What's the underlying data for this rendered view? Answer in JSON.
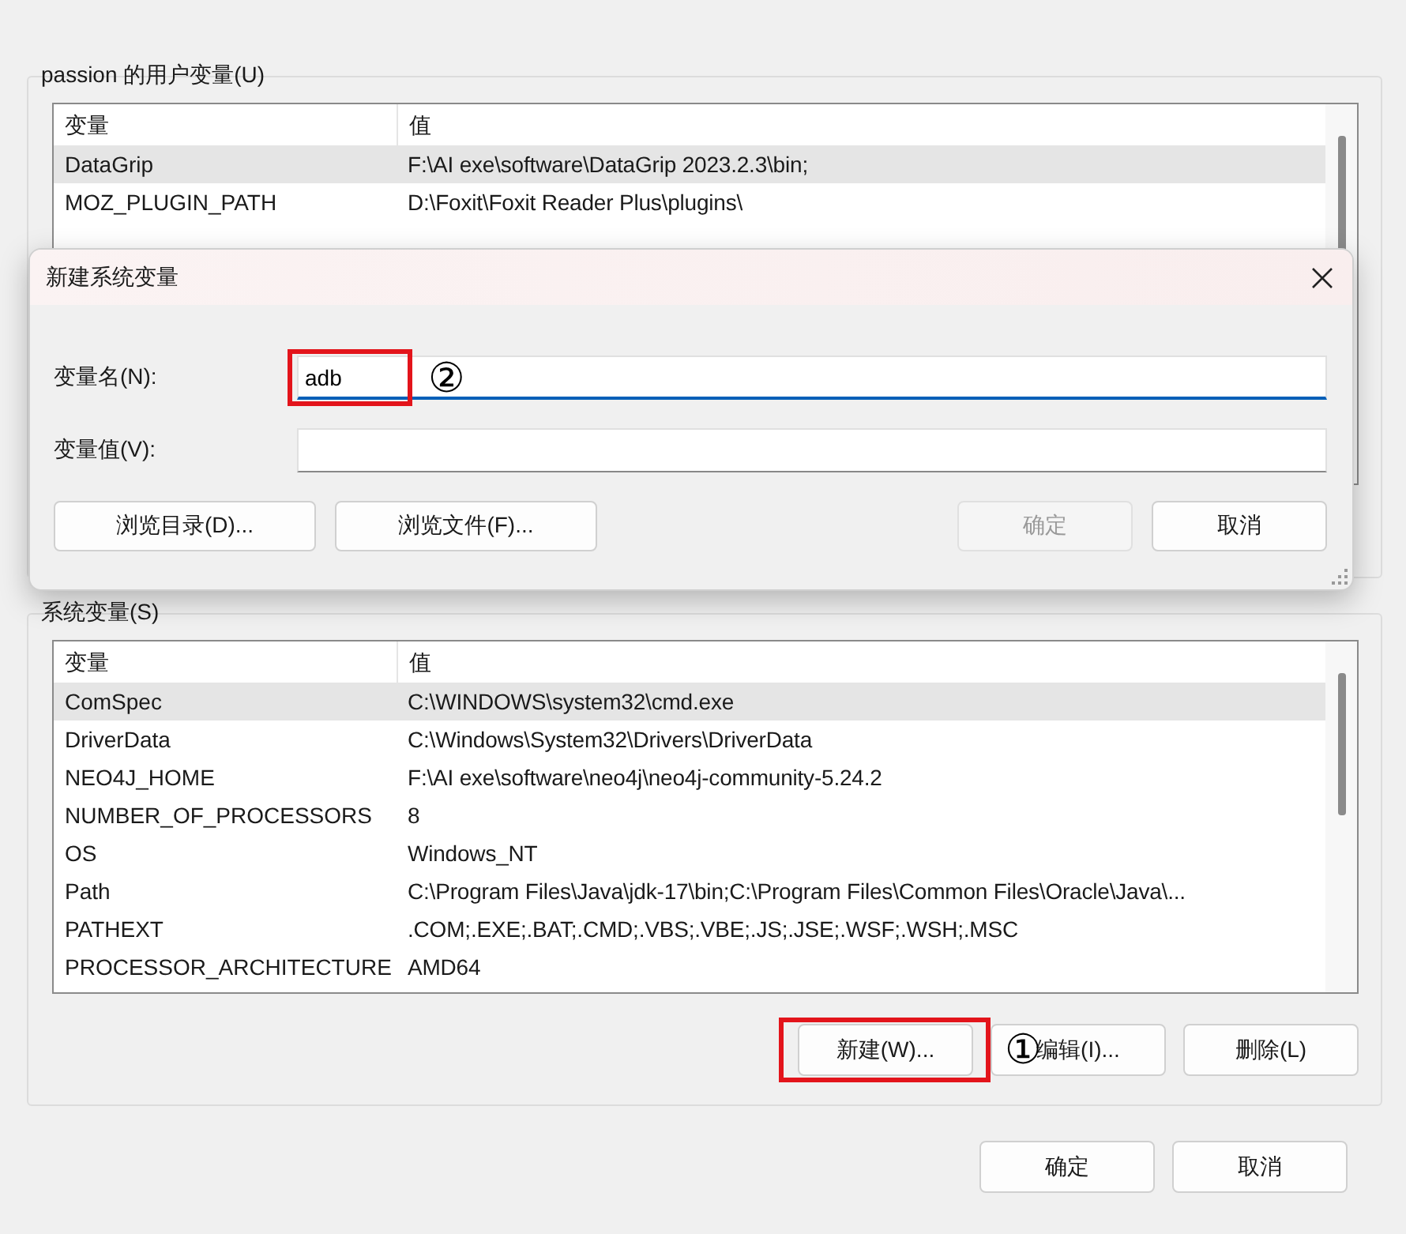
{
  "user_variables": {
    "title": "passion 的用户变量(U)",
    "columns": [
      "变量",
      "值"
    ],
    "rows": [
      {
        "name": "DataGrip",
        "value": "F:\\AI exe\\software\\DataGrip 2023.2.3\\bin;",
        "selected": true
      },
      {
        "name": "MOZ_PLUGIN_PATH",
        "value": "D:\\Foxit\\Foxit Reader Plus\\plugins\\",
        "selected": false
      }
    ]
  },
  "dialog": {
    "title": "新建系统变量",
    "fields": [
      {
        "label": "变量名(N):",
        "value": "adb",
        "focused": true,
        "highlighted": true,
        "annotation": "②"
      },
      {
        "label": "变量值(V):",
        "focused": false,
        "highlighted": false
      }
    ],
    "browse_buttons": [
      {
        "label": "浏览目录(D)...",
        "disabled": false
      },
      {
        "label": "浏览文件(F)...",
        "disabled": false
      }
    ],
    "buttons": [
      {
        "label": "确定",
        "disabled": true
      },
      {
        "label": "取消",
        "disabled": false
      }
    ]
  },
  "system_variables": {
    "title": "系统变量(S)",
    "columns": [
      "变量",
      "值"
    ],
    "rows": [
      {
        "name": "ComSpec",
        "value": "C:\\WINDOWS\\system32\\cmd.exe",
        "selected": true
      },
      {
        "name": "DriverData",
        "value": "C:\\Windows\\System32\\Drivers\\DriverData",
        "selected": false
      },
      {
        "name": "NEO4J_HOME",
        "value": "F:\\AI exe\\software\\neo4j\\neo4j-community-5.24.2",
        "selected": false
      },
      {
        "name": "NUMBER_OF_PROCESSORS",
        "value": "8",
        "selected": false
      },
      {
        "name": "OS",
        "value": "Windows_NT",
        "selected": false
      },
      {
        "name": "Path",
        "value": "C:\\Program Files\\Java\\jdk-17\\bin;C:\\Program Files\\Common Files\\Oracle\\Java\\...",
        "selected": false
      },
      {
        "name": "PATHEXT",
        "value": ".COM;.EXE;.BAT;.CMD;.VBS;.VBE;.JS;.JSE;.WSF;.WSH;.MSC",
        "selected": false
      },
      {
        "name": "PROCESSOR_ARCHITECTURE",
        "value": "AMD64",
        "selected": false
      }
    ],
    "buttons": [
      {
        "label": "新建(W)...",
        "highlighted": true,
        "annotation": "①"
      },
      {
        "label": "编辑(I)...",
        "highlighted": false
      },
      {
        "label": "删除(L)",
        "highlighted": false
      }
    ]
  },
  "footer_buttons": [
    {
      "label": "确定"
    },
    {
      "label": "取消"
    }
  ]
}
